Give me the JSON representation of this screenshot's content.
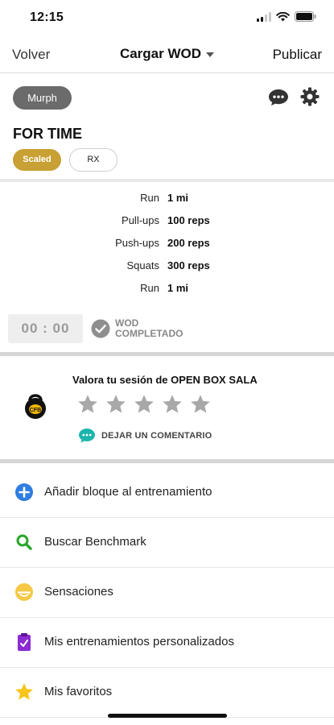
{
  "status_bar": {
    "time": "12:15"
  },
  "nav": {
    "back_label": "Volver",
    "title": "Cargar WOD",
    "publish_label": "Publicar"
  },
  "wod": {
    "name": "Murph",
    "type": "FOR TIME",
    "scaled_label": "Scaled",
    "rx_label": "RX",
    "selected_level": "Scaled",
    "accent_color": "#c8a033",
    "exercises": [
      {
        "name": "Run",
        "amount": "1 mi"
      },
      {
        "name": "Pull-ups",
        "amount": "100 reps"
      },
      {
        "name": "Push-ups",
        "amount": "200 reps"
      },
      {
        "name": "Squats",
        "amount": "300 reps"
      },
      {
        "name": "Run",
        "amount": "1 mi"
      }
    ],
    "timer": "00 : 00",
    "completed_line1": "WOD",
    "completed_line2": "COMPLETADO"
  },
  "rating": {
    "title": "Valora tu sesión de OPEN BOX SALA",
    "stars_total": 5,
    "stars_filled": 0,
    "comment_label": "DEJAR UN COMENTARIO",
    "comment_color": "#1cb5ad"
  },
  "menu": {
    "items": [
      {
        "label": "Añadir bloque al entrenamiento",
        "icon": "plus-circle-icon",
        "color": "#2f7de1"
      },
      {
        "label": "Buscar Benchmark",
        "icon": "search-icon",
        "color": "#2aa52a"
      },
      {
        "label": "Sensaciones",
        "icon": "emoji-icon",
        "color": "#f5c845"
      },
      {
        "label": "Mis entrenamientos personalizados",
        "icon": "clipboard-icon",
        "color": "#8b2bd1"
      },
      {
        "label": "Mis favoritos",
        "icon": "star-icon",
        "color": "#f5c518"
      }
    ]
  }
}
